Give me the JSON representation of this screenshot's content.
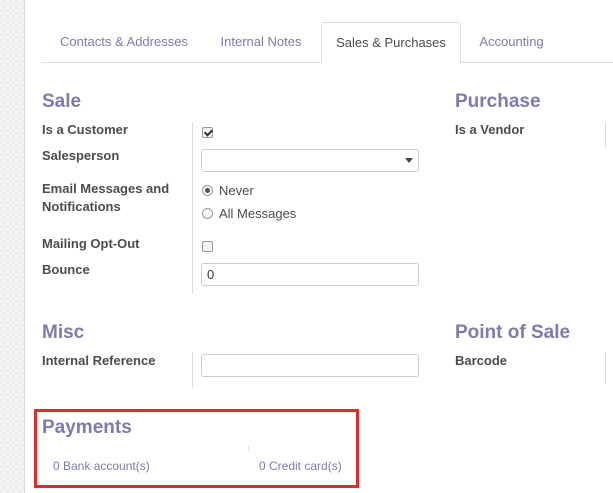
{
  "tabs": [
    {
      "label": "Contacts & Addresses"
    },
    {
      "label": "Internal Notes"
    },
    {
      "label": "Sales & Purchases",
      "active": true
    },
    {
      "label": "Accounting"
    }
  ],
  "sale": {
    "title": "Sale",
    "is_customer_label": "Is a Customer",
    "is_customer_checked": true,
    "salesperson_label": "Salesperson",
    "salesperson_value": "",
    "email_label": "Email Messages and Notifications",
    "email_options": [
      "Never",
      "All Messages"
    ],
    "email_selected": "Never",
    "mailing_optout_label": "Mailing Opt-Out",
    "mailing_optout_checked": false,
    "bounce_label": "Bounce",
    "bounce_value": "0"
  },
  "purchase": {
    "title": "Purchase",
    "is_vendor_label": "Is a Vendor"
  },
  "misc": {
    "title": "Misc",
    "internal_ref_label": "Internal Reference",
    "internal_ref_value": ""
  },
  "pos": {
    "title": "Point of Sale",
    "barcode_label": "Barcode"
  },
  "payments": {
    "title": "Payments",
    "bank_accounts": "0 Bank account(s)",
    "credit_cards": "0 Credit card(s)"
  },
  "colors": {
    "accent": "#7c7bad",
    "highlight": "#e02b2b"
  }
}
